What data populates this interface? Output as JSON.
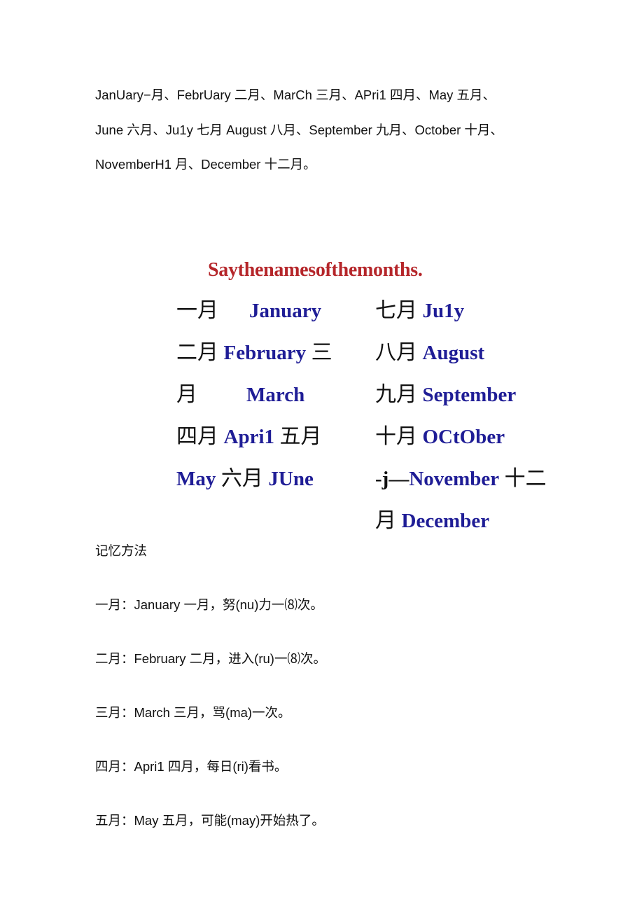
{
  "intro": {
    "lines": [
      "JanUary−月、FebrUary 二月、MarCh 三月、APri1 四月、May 五月、",
      "June 六月、Ju1y 七月 August 八月、September 九月、October 十月、",
      "NovemberH1 月、December 十二月。"
    ]
  },
  "section_title": "Saythenamesofthemonths.",
  "left_column": [
    {
      "zh": "一月",
      "en": "January"
    },
    {
      "zh": "二月",
      "en": "February",
      "zh2": "三"
    },
    {
      "zh": "月",
      "en": "March"
    },
    {
      "zh": "四月",
      "en": "Apri1",
      "zh2": "五月"
    },
    {
      "en": "May",
      "zh": "六月",
      "en2": "JUne"
    }
  ],
  "right_column": [
    {
      "zh": "七月",
      "en": "Ju1y"
    },
    {
      "zh": "八月",
      "en": "August"
    },
    {
      "zh": "九月",
      "en": "September"
    },
    {
      "zh": "十月",
      "en": "OCtOber"
    },
    {
      "prefix": "-j—",
      "en": "November",
      "zh2": "十二"
    },
    {
      "zh": "月",
      "en": "December"
    }
  ],
  "memory": {
    "heading": "记忆方法",
    "items": [
      "一月：January 一月，努(nu)力一⑻次。",
      "二月：February 二月，进入(ru)一⑻次。",
      "三月：March 三月，骂(ma)一次。",
      "四月：Apri1 四月，每日(ri)看书。",
      "五月：May 五月，可能(may)开始热了。"
    ]
  },
  "colors": {
    "title": "#b5262a",
    "english_month": "#1f1d96",
    "text": "#111111"
  }
}
